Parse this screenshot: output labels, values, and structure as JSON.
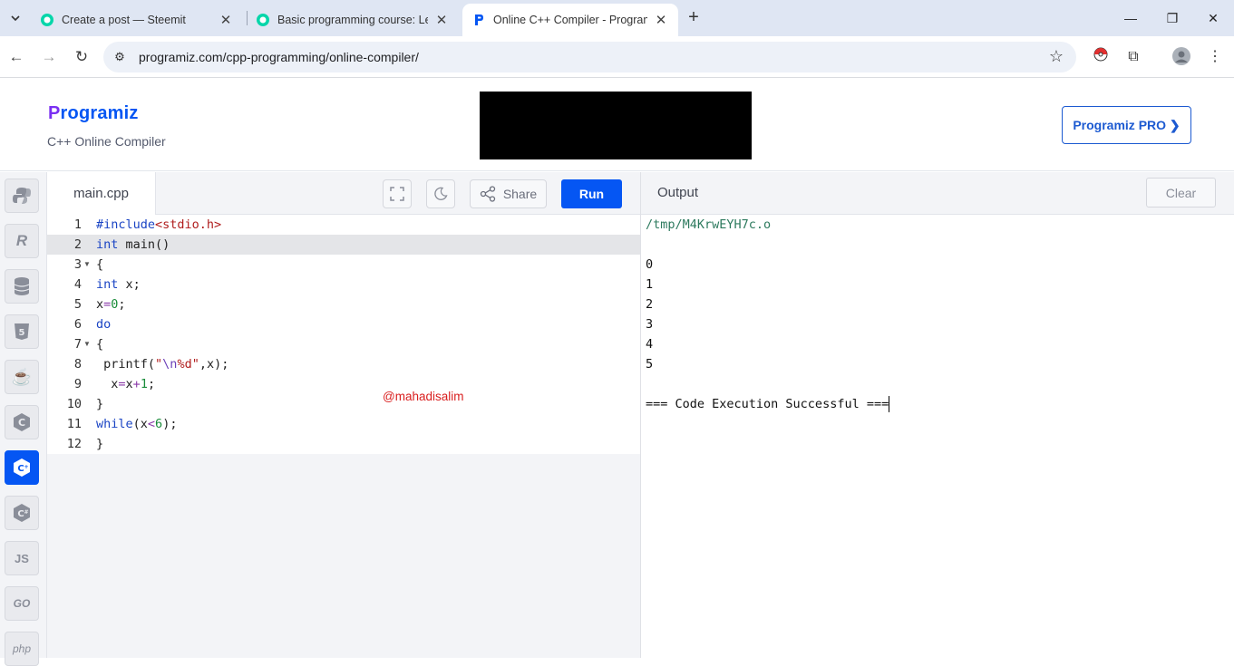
{
  "browser": {
    "tabs": [
      {
        "title": "Create a post — Steemit",
        "active": false
      },
      {
        "title": "Basic programming course: Less",
        "active": false
      },
      {
        "title": "Online C++ Compiler - Program",
        "active": true
      }
    ],
    "url": "programiz.com/cpp-programming/online-compiler/"
  },
  "site": {
    "logo_initial": "P",
    "logo_rest": "rogramiz",
    "subtitle": "C++ Online Compiler",
    "pro_button": "Programiz PRO ❯"
  },
  "rail": {
    "languages": [
      {
        "name": "python",
        "glyph": "🐍"
      },
      {
        "name": "r",
        "glyph": "R"
      },
      {
        "name": "sql",
        "glyph": "≡"
      },
      {
        "name": "html",
        "glyph": "5"
      },
      {
        "name": "java",
        "glyph": "☕"
      },
      {
        "name": "c",
        "glyph": "C"
      },
      {
        "name": "cpp",
        "glyph": "C",
        "active": true
      },
      {
        "name": "csharp",
        "glyph": "C"
      },
      {
        "name": "javascript",
        "glyph": "JS"
      },
      {
        "name": "go",
        "glyph": "GO"
      },
      {
        "name": "php",
        "glyph": "php"
      }
    ]
  },
  "editor": {
    "file_name": "main.cpp",
    "share_label": "Share",
    "run_label": "Run",
    "line_numbers": [
      "1",
      "2",
      "3",
      "4",
      "5",
      "6",
      "7",
      "8",
      "9",
      "10",
      "11",
      "12"
    ],
    "code": {
      "l1a": "#include",
      "l1b": "<stdio.h>",
      "l2a": "int",
      "l2b": " main()",
      "l3": "{",
      "l4a": "int",
      "l4b": " x;",
      "l5a": "x",
      "l5b": "=",
      "l5c": "0",
      "l5d": ";",
      "l6": "do",
      "l7": "{",
      "l8a": " printf(",
      "l8b": "\"",
      "l8c": "\\n",
      "l8d": "%d\"",
      "l8e": ",x);",
      "l9a": "  x",
      "l9b": "=",
      "l9c": "x",
      "l9d": "+",
      "l9e": "1",
      "l9f": ";",
      "l10": "}",
      "l11a": "while",
      "l11b": "(x",
      "l11c": "<",
      "l11d": "6",
      "l11e": ");",
      "l12": "}"
    },
    "watermark": "@mahadisalim"
  },
  "output": {
    "title": "Output",
    "clear_label": "Clear",
    "lines": [
      "/tmp/M4KrwEYH7c.o",
      "",
      "0",
      "1",
      "2",
      "3",
      "4",
      "5",
      "",
      "=== Code Execution Successful ==="
    ]
  },
  "colors": {
    "accent": "#0556f3",
    "logo_p": "#7a2ff2",
    "watermark": "#d91e1e"
  }
}
